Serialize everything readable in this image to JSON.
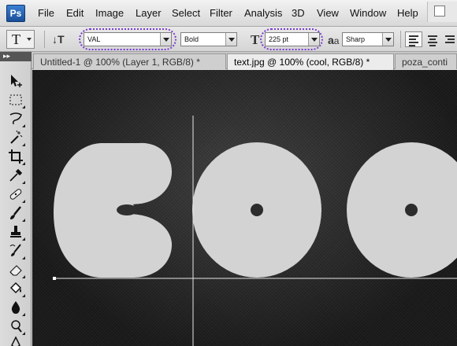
{
  "app": {
    "logo": "Ps"
  },
  "menu": [
    "File",
    "Edit",
    "Image",
    "Layer",
    "Select",
    "Filter",
    "Analysis",
    "3D",
    "View",
    "Window",
    "Help"
  ],
  "options": {
    "tool_glyph": "T",
    "orientation_glyph": "↓T",
    "font_family": "VAL",
    "font_style": "Bold",
    "font_size": "225 pt",
    "aa_label": "a",
    "aa_label_big": "a",
    "antialias": "Sharp",
    "highlight_color": "#7a3cd0"
  },
  "tabs": [
    {
      "label": "Untitled-1 @ 100% (Layer 1, RGB/8) *",
      "active": false
    },
    {
      "label": "text.jpg @ 100% (cool, RGB/8) *",
      "active": true
    },
    {
      "label": "poza_conti",
      "active": false
    }
  ],
  "toolbox": {
    "header": "▸▸",
    "tools": [
      "move-tool",
      "marquee-tool",
      "lasso-tool",
      "magic-wand-tool",
      "crop-tool",
      "eyedropper-tool",
      "healing-brush-tool",
      "brush-tool",
      "clone-stamp-tool",
      "history-brush-tool",
      "eraser-tool",
      "paint-bucket-tool",
      "blur-tool",
      "dodge-tool",
      "pen-tool"
    ]
  },
  "canvas": {
    "text": "cool",
    "letter_color": "#d3d3d3",
    "background": "dark textured",
    "guide_color": "#e6e6e6"
  }
}
